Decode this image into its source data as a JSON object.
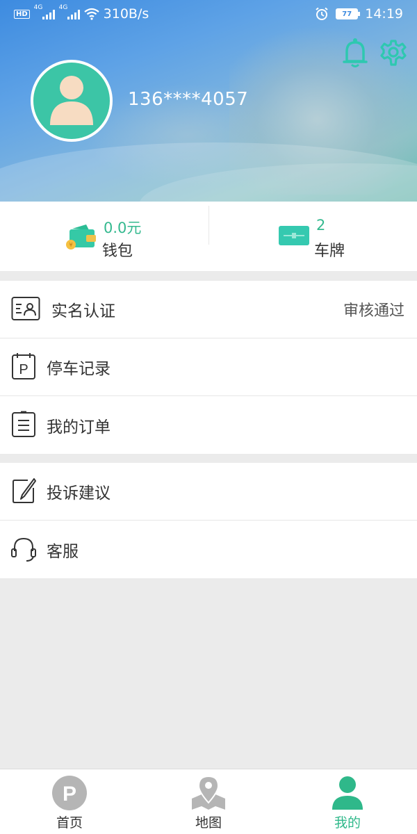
{
  "status_bar": {
    "hd": "HD",
    "net1": "4G",
    "net2": "4G",
    "speed": "310B/s",
    "battery": "77",
    "time": "14:19"
  },
  "header": {
    "phone": "136****4057",
    "icons": [
      "bell-icon",
      "gear-icon",
      "avatar-icon"
    ]
  },
  "stats": {
    "wallet": {
      "value": "0.0元",
      "label": "钱包"
    },
    "plates": {
      "value": "2",
      "label": "车牌"
    }
  },
  "menu_group1": [
    {
      "label": "实名认证",
      "value": "审核通过",
      "icon": "id-card-icon"
    },
    {
      "label": "停车记录",
      "icon": "parking-record-icon"
    },
    {
      "label": "我的订单",
      "icon": "order-list-icon"
    }
  ],
  "menu_group2": [
    {
      "label": "投诉建议",
      "icon": "complaint-edit-icon"
    },
    {
      "label": "客服",
      "icon": "headset-icon"
    }
  ],
  "tabs": [
    {
      "label": "首页",
      "icon": "parking-icon"
    },
    {
      "label": "地图",
      "icon": "map-pin-icon"
    },
    {
      "label": "我的",
      "icon": "user-icon",
      "active": true
    }
  ],
  "colors": {
    "accent": "#2fb88a",
    "header_blue": "#3d8be0",
    "avatar_bg": "#3cc5a6"
  }
}
